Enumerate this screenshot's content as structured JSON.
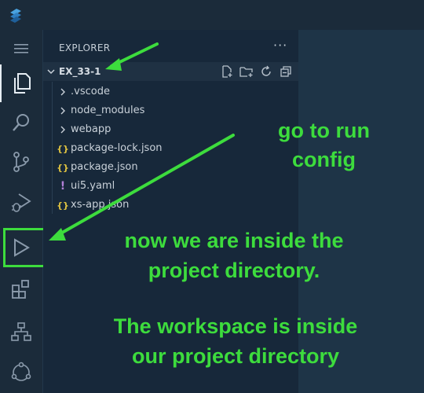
{
  "explorer": {
    "header": "EXPLORER",
    "more_actions": "···",
    "workspace_title": "EX_33-1",
    "items": [
      {
        "label": ".vscode",
        "type": "folder"
      },
      {
        "label": "node_modules",
        "type": "folder"
      },
      {
        "label": "webapp",
        "type": "folder"
      },
      {
        "label": "package-lock.json",
        "type": "json",
        "icon_glyph": "{}"
      },
      {
        "label": "package.json",
        "type": "json",
        "icon_glyph": "{}"
      },
      {
        "label": "ui5.yaml",
        "type": "yaml",
        "icon_glyph": "!"
      },
      {
        "label": "xs-app.json",
        "type": "json",
        "icon_glyph": "{}"
      }
    ]
  },
  "activity_bar": {
    "icons": [
      "menu-icon",
      "files-icon",
      "search-icon",
      "source-control-icon",
      "run-debug-icon",
      "run-config-icon",
      "extensions-icon",
      "org-chart-icon",
      "network-icon"
    ]
  },
  "annotations": {
    "note1": [
      "go to run",
      "config"
    ],
    "note2": [
      "now we are inside the",
      "project directory."
    ],
    "note3": [
      "The workspace is inside",
      "our project directory"
    ]
  },
  "colors": {
    "annotation_green": "#3ddc3d",
    "sidebar_bg": "#17283a",
    "activitybar_bg": "#1b2b3a",
    "json_icon": "#e2c541",
    "yaml_icon": "#b180d7"
  }
}
